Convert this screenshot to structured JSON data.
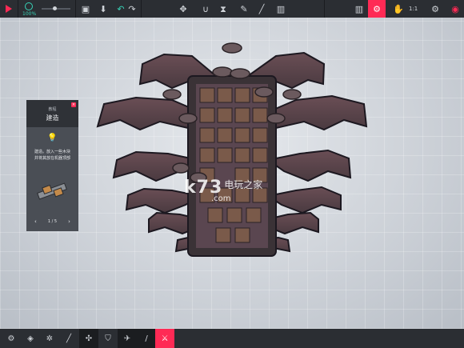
{
  "topbar": {
    "speed_label": "100%",
    "block_count": "1:1",
    "icons": [
      "play-icon",
      "speed-icon",
      "time-slider",
      "save-icon",
      "load-icon",
      "undo-icon",
      "redo-icon",
      "move-icon",
      "magnet-icon",
      "mirror-icon",
      "pen-icon",
      "delete-icon",
      "stats-icon",
      "settings-gear-icon",
      "hand-icon",
      "cloud-icon",
      "options-icon",
      "close-icon"
    ]
  },
  "panel": {
    "subtitle": "教程",
    "title": "建造",
    "body_line1": "建造。放入一些木块",
    "body_line2": "并将其放在机器顶部",
    "page": "1 / 5",
    "prev": "‹",
    "next": "›"
  },
  "bottombar": {
    "icons": [
      "settings-icon",
      "shield-icon",
      "gear-cluster-icon",
      "wrench-icon",
      "fan-icon",
      "armor-icon",
      "flying-machine-icon",
      "stick-icon",
      "weapon-icon"
    ]
  },
  "watermark": {
    "logo": "k73",
    "cn": "电玩之家",
    "url": ".com"
  },
  "colors": {
    "accent": "#ff2a55",
    "toolbar": "#2b2e33",
    "speed": "#37d3b7",
    "wing": "#5a4248"
  }
}
